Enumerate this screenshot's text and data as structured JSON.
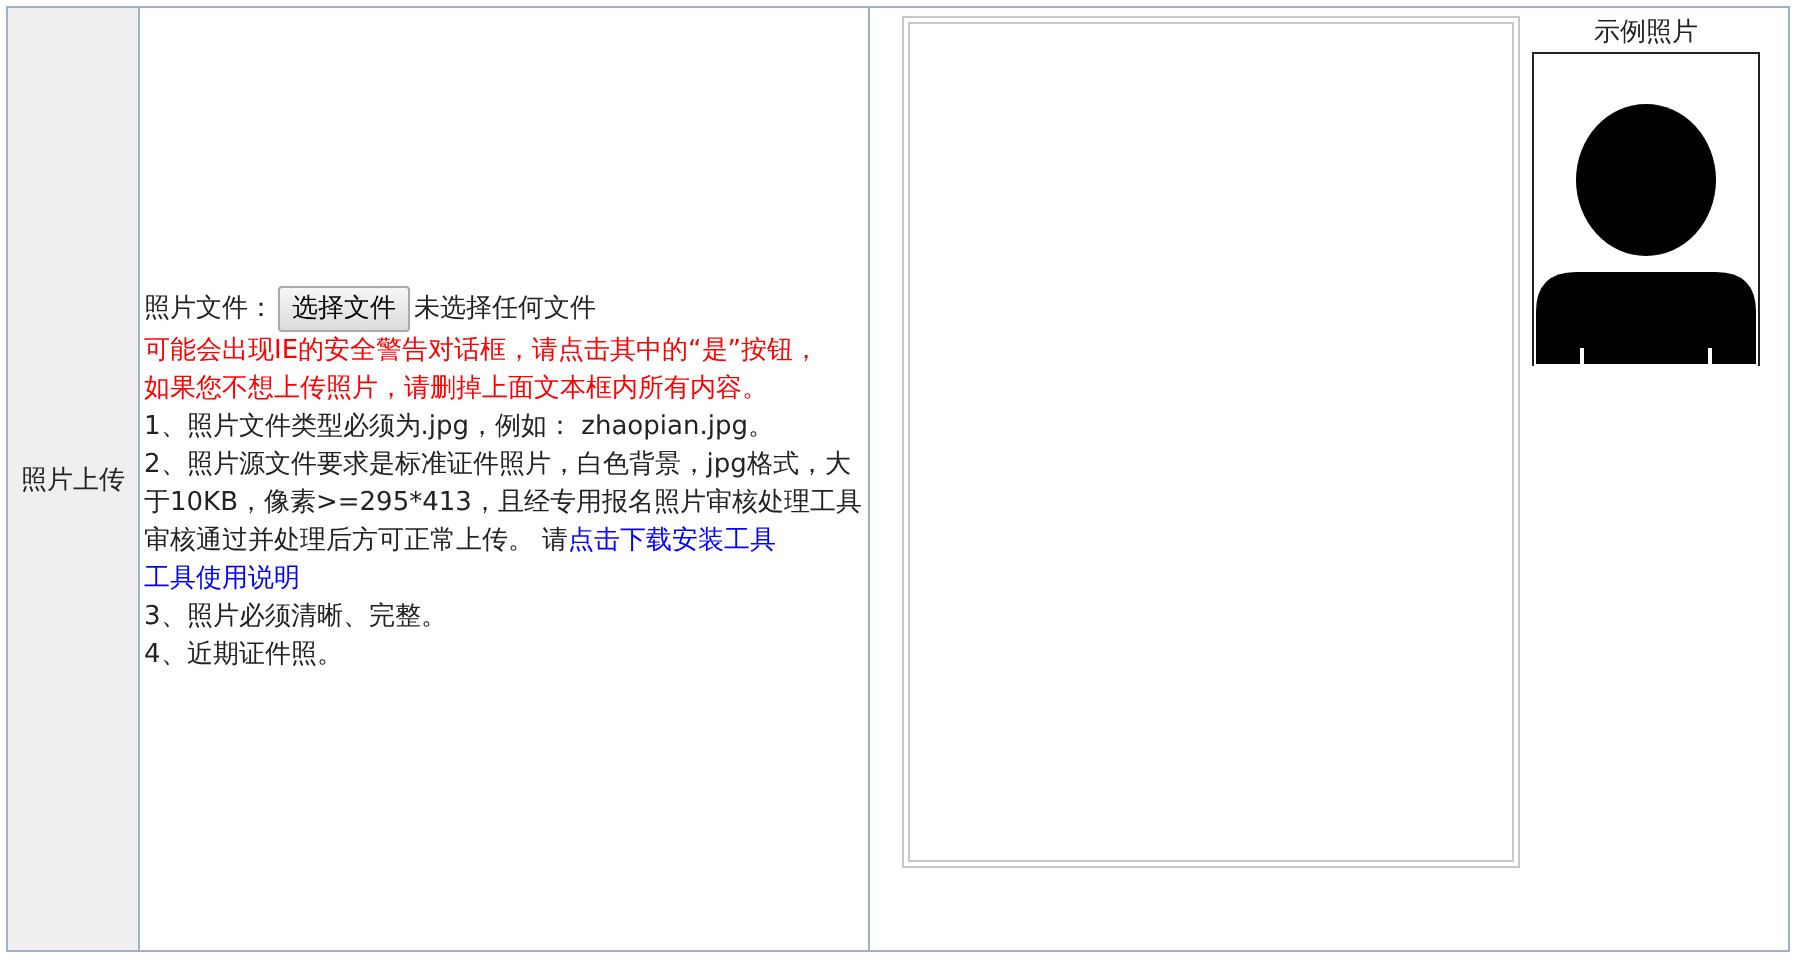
{
  "row_label": "照片上传",
  "file": {
    "label": "照片文件：",
    "button": "选择文件",
    "status": "未选择任何文件"
  },
  "warnings": [
    "可能会出现IE的安全警告对话框，请点击其中的“是”按钮，",
    "如果您不想上传照片，请删掉上面文本框内所有内容。"
  ],
  "rules": [
    {
      "text": "1、照片文件类型必须为.jpg，例如： zhaopian.jpg。"
    },
    {
      "text": "2、照片源文件要求是标准证件照片，白色背景，jpg格式，大于10KB，像素>=295*413，且经专用报名照片审核处理工具审核通过并处理后方可正常上传。 请",
      "links": [
        "点击下载安装工具",
        "工具使用说明"
      ]
    },
    {
      "text": "3、照片必须清晰、完整。"
    },
    {
      "text": "4、近期证件照。"
    }
  ],
  "sample": {
    "caption": "示例照片"
  }
}
